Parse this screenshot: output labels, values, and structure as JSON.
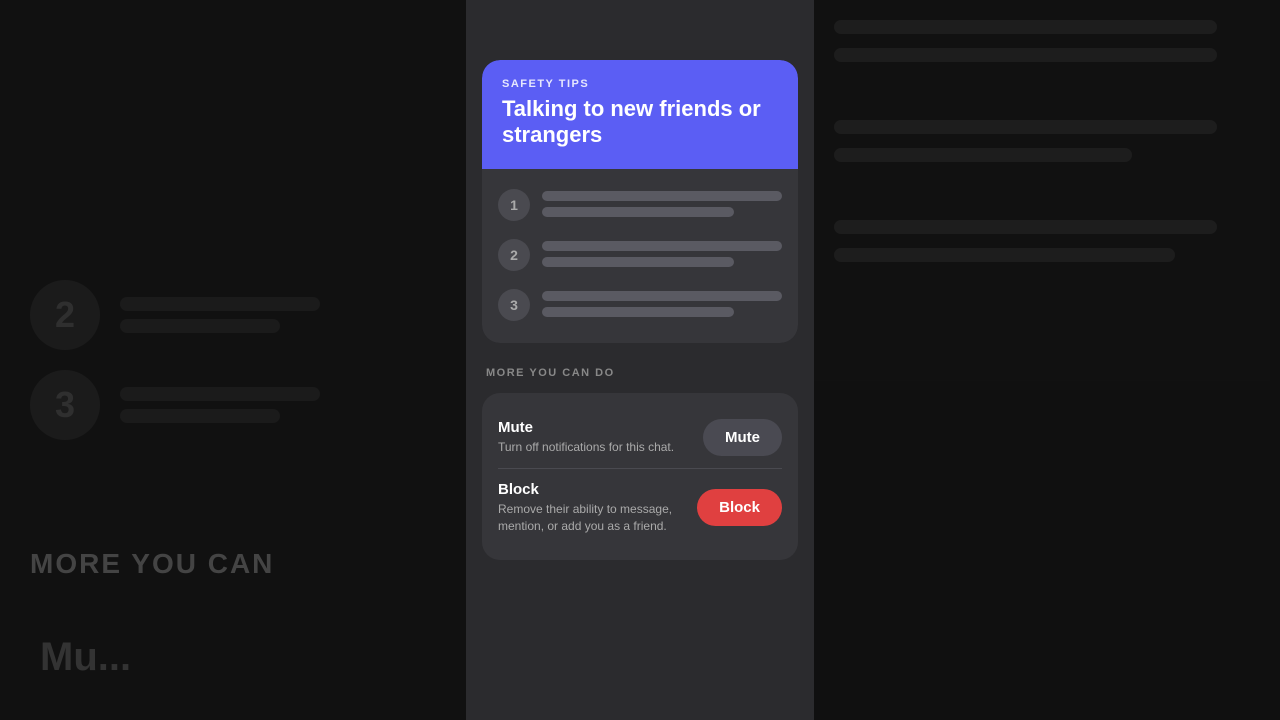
{
  "background": {
    "numbers": [
      "2",
      "3"
    ],
    "more_text": "MORE YOU CAN",
    "bottom_text": "Mu..."
  },
  "safety_card": {
    "label": "SAFETY TIPS",
    "title": "Talking to new friends or strangers",
    "tips": [
      {
        "number": "1"
      },
      {
        "number": "2"
      },
      {
        "number": "3"
      }
    ]
  },
  "more_section": {
    "label": "MORE YOU CAN DO",
    "rows": [
      {
        "title": "Mute",
        "description": "Turn off notifications for this chat.",
        "button_label": "Mute",
        "button_type": "mute"
      },
      {
        "title": "Block",
        "description": "Remove their ability to message, mention, or add you as a friend.",
        "button_label": "Block",
        "button_type": "block"
      }
    ]
  }
}
